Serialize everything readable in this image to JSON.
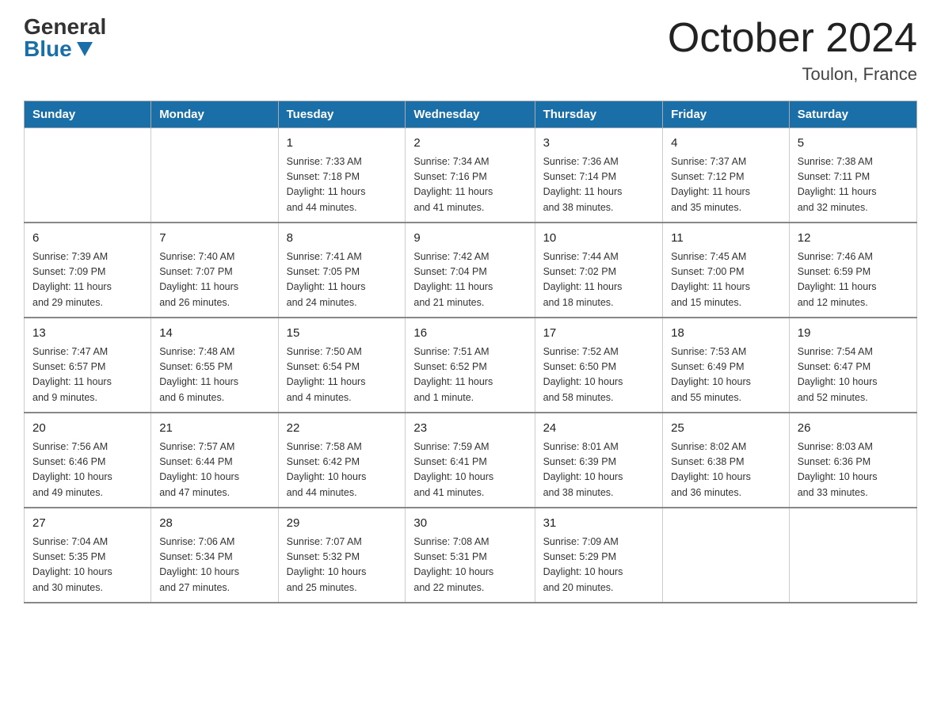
{
  "logo": {
    "general": "General",
    "blue": "Blue"
  },
  "title": "October 2024",
  "location": "Toulon, France",
  "weekdays": [
    "Sunday",
    "Monday",
    "Tuesday",
    "Wednesday",
    "Thursday",
    "Friday",
    "Saturday"
  ],
  "weeks": [
    [
      {
        "day": "",
        "info": ""
      },
      {
        "day": "",
        "info": ""
      },
      {
        "day": "1",
        "info": "Sunrise: 7:33 AM\nSunset: 7:18 PM\nDaylight: 11 hours\nand 44 minutes."
      },
      {
        "day": "2",
        "info": "Sunrise: 7:34 AM\nSunset: 7:16 PM\nDaylight: 11 hours\nand 41 minutes."
      },
      {
        "day": "3",
        "info": "Sunrise: 7:36 AM\nSunset: 7:14 PM\nDaylight: 11 hours\nand 38 minutes."
      },
      {
        "day": "4",
        "info": "Sunrise: 7:37 AM\nSunset: 7:12 PM\nDaylight: 11 hours\nand 35 minutes."
      },
      {
        "day": "5",
        "info": "Sunrise: 7:38 AM\nSunset: 7:11 PM\nDaylight: 11 hours\nand 32 minutes."
      }
    ],
    [
      {
        "day": "6",
        "info": "Sunrise: 7:39 AM\nSunset: 7:09 PM\nDaylight: 11 hours\nand 29 minutes."
      },
      {
        "day": "7",
        "info": "Sunrise: 7:40 AM\nSunset: 7:07 PM\nDaylight: 11 hours\nand 26 minutes."
      },
      {
        "day": "8",
        "info": "Sunrise: 7:41 AM\nSunset: 7:05 PM\nDaylight: 11 hours\nand 24 minutes."
      },
      {
        "day": "9",
        "info": "Sunrise: 7:42 AM\nSunset: 7:04 PM\nDaylight: 11 hours\nand 21 minutes."
      },
      {
        "day": "10",
        "info": "Sunrise: 7:44 AM\nSunset: 7:02 PM\nDaylight: 11 hours\nand 18 minutes."
      },
      {
        "day": "11",
        "info": "Sunrise: 7:45 AM\nSunset: 7:00 PM\nDaylight: 11 hours\nand 15 minutes."
      },
      {
        "day": "12",
        "info": "Sunrise: 7:46 AM\nSunset: 6:59 PM\nDaylight: 11 hours\nand 12 minutes."
      }
    ],
    [
      {
        "day": "13",
        "info": "Sunrise: 7:47 AM\nSunset: 6:57 PM\nDaylight: 11 hours\nand 9 minutes."
      },
      {
        "day": "14",
        "info": "Sunrise: 7:48 AM\nSunset: 6:55 PM\nDaylight: 11 hours\nand 6 minutes."
      },
      {
        "day": "15",
        "info": "Sunrise: 7:50 AM\nSunset: 6:54 PM\nDaylight: 11 hours\nand 4 minutes."
      },
      {
        "day": "16",
        "info": "Sunrise: 7:51 AM\nSunset: 6:52 PM\nDaylight: 11 hours\nand 1 minute."
      },
      {
        "day": "17",
        "info": "Sunrise: 7:52 AM\nSunset: 6:50 PM\nDaylight: 10 hours\nand 58 minutes."
      },
      {
        "day": "18",
        "info": "Sunrise: 7:53 AM\nSunset: 6:49 PM\nDaylight: 10 hours\nand 55 minutes."
      },
      {
        "day": "19",
        "info": "Sunrise: 7:54 AM\nSunset: 6:47 PM\nDaylight: 10 hours\nand 52 minutes."
      }
    ],
    [
      {
        "day": "20",
        "info": "Sunrise: 7:56 AM\nSunset: 6:46 PM\nDaylight: 10 hours\nand 49 minutes."
      },
      {
        "day": "21",
        "info": "Sunrise: 7:57 AM\nSunset: 6:44 PM\nDaylight: 10 hours\nand 47 minutes."
      },
      {
        "day": "22",
        "info": "Sunrise: 7:58 AM\nSunset: 6:42 PM\nDaylight: 10 hours\nand 44 minutes."
      },
      {
        "day": "23",
        "info": "Sunrise: 7:59 AM\nSunset: 6:41 PM\nDaylight: 10 hours\nand 41 minutes."
      },
      {
        "day": "24",
        "info": "Sunrise: 8:01 AM\nSunset: 6:39 PM\nDaylight: 10 hours\nand 38 minutes."
      },
      {
        "day": "25",
        "info": "Sunrise: 8:02 AM\nSunset: 6:38 PM\nDaylight: 10 hours\nand 36 minutes."
      },
      {
        "day": "26",
        "info": "Sunrise: 8:03 AM\nSunset: 6:36 PM\nDaylight: 10 hours\nand 33 minutes."
      }
    ],
    [
      {
        "day": "27",
        "info": "Sunrise: 7:04 AM\nSunset: 5:35 PM\nDaylight: 10 hours\nand 30 minutes."
      },
      {
        "day": "28",
        "info": "Sunrise: 7:06 AM\nSunset: 5:34 PM\nDaylight: 10 hours\nand 27 minutes."
      },
      {
        "day": "29",
        "info": "Sunrise: 7:07 AM\nSunset: 5:32 PM\nDaylight: 10 hours\nand 25 minutes."
      },
      {
        "day": "30",
        "info": "Sunrise: 7:08 AM\nSunset: 5:31 PM\nDaylight: 10 hours\nand 22 minutes."
      },
      {
        "day": "31",
        "info": "Sunrise: 7:09 AM\nSunset: 5:29 PM\nDaylight: 10 hours\nand 20 minutes."
      },
      {
        "day": "",
        "info": ""
      },
      {
        "day": "",
        "info": ""
      }
    ]
  ]
}
